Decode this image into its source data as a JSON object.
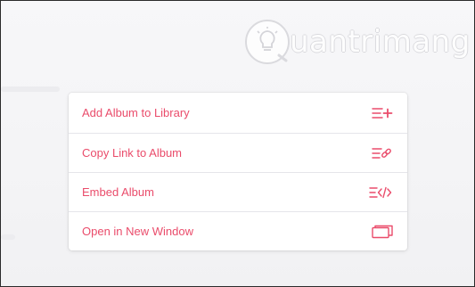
{
  "watermark": {
    "text": "uantrimang",
    "logo_icon": "quantrimang-lightbulb-logo"
  },
  "accent_color": "#ea4c6b",
  "menu": {
    "items": [
      {
        "label": "Add Album to Library",
        "icon": "list-add-icon"
      },
      {
        "label": "Copy Link to Album",
        "icon": "list-link-icon"
      },
      {
        "label": "Embed Album",
        "icon": "list-code-icon"
      },
      {
        "label": "Open in New Window",
        "icon": "new-window-icon"
      }
    ]
  }
}
